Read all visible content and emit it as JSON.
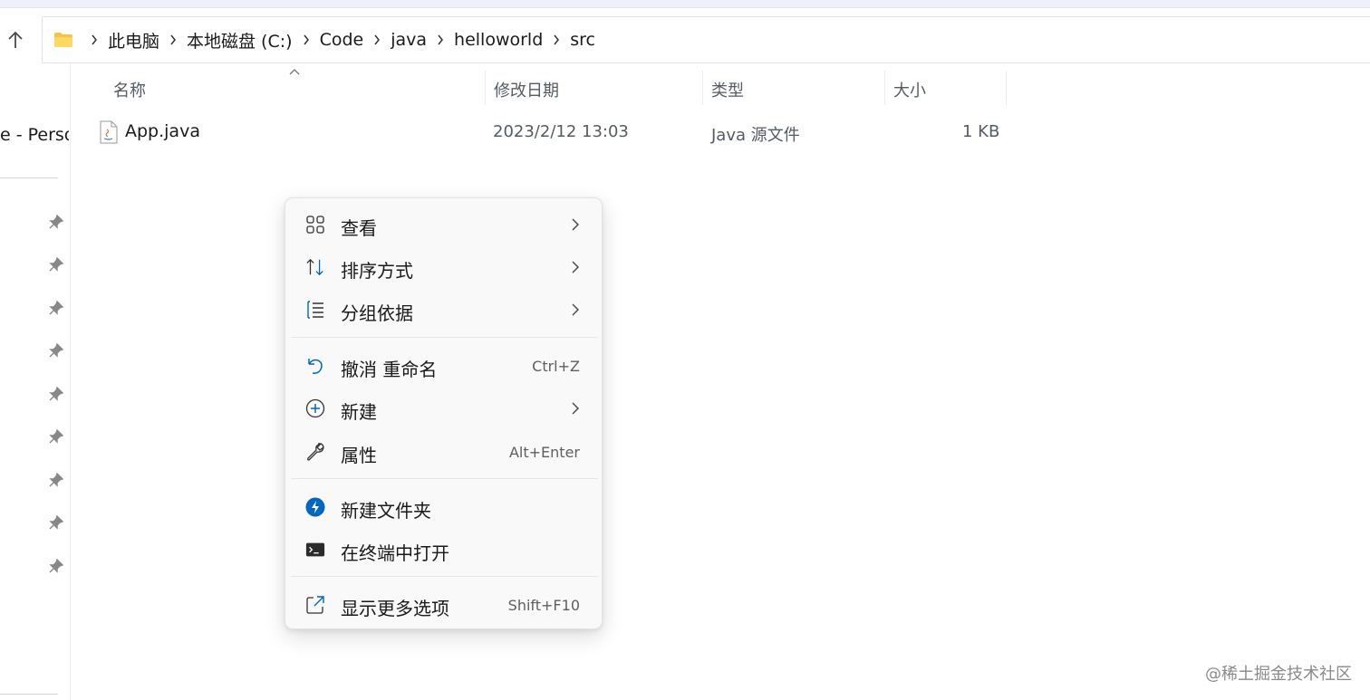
{
  "breadcrumb": [
    "此电脑",
    "本地磁盘 (C:)",
    "Code",
    "java",
    "helloworld",
    "src"
  ],
  "sidebar": {
    "partial_label": "e - Persor"
  },
  "columns": {
    "name": "名称",
    "modified": "修改日期",
    "type": "类型",
    "size": "大小"
  },
  "files": [
    {
      "name": "App.java",
      "modified": "2023/2/12 13:03",
      "type": "Java 源文件",
      "size": "1 KB"
    }
  ],
  "context_menu": {
    "view": {
      "label": "查看"
    },
    "sort": {
      "label": "排序方式"
    },
    "group": {
      "label": "分组依据"
    },
    "undo": {
      "label": "撤消 重命名",
      "shortcut": "Ctrl+Z"
    },
    "new": {
      "label": "新建"
    },
    "properties": {
      "label": "属性",
      "shortcut": "Alt+Enter"
    },
    "new_folder": {
      "label": "新建文件夹"
    },
    "open_terminal": {
      "label": "在终端中打开"
    },
    "more_options": {
      "label": "显示更多选项",
      "shortcut": "Shift+F10"
    }
  },
  "watermark": "@稀土掘金技术社区",
  "colors": {
    "accent": "#0067c0",
    "folder": "#f4c542"
  }
}
